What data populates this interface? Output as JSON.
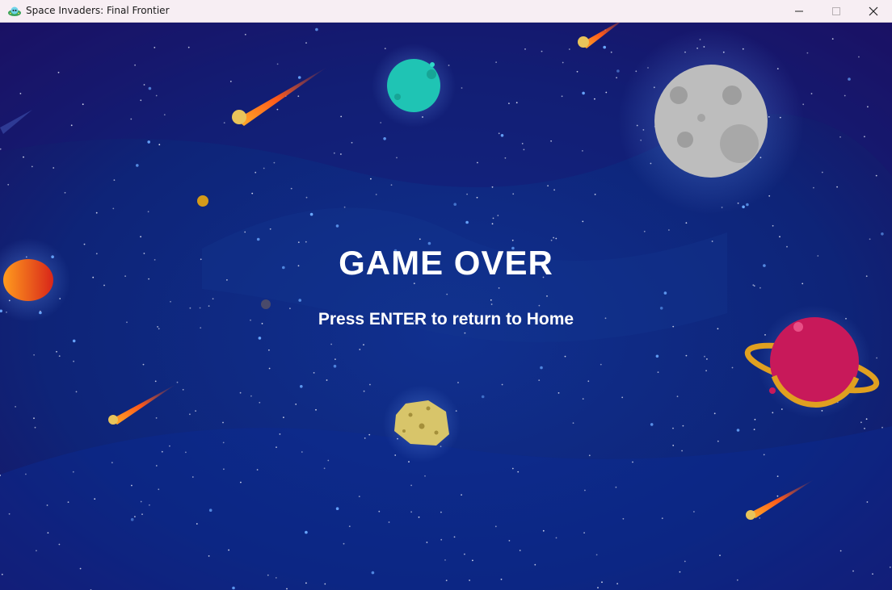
{
  "window": {
    "title": "Space Invaders: Final Frontier",
    "icon": "alien-ufo-icon",
    "controls": [
      "minimize-icon",
      "maximize-icon",
      "close-icon"
    ]
  },
  "game": {
    "headline": "GAME OVER",
    "prompt": "Press ENTER to return to Home"
  },
  "colors": {
    "titlebar": "#f7eef3",
    "space_dark": "#1c0f5e",
    "space_blue": "#0e2a8a",
    "text": "#ffffff",
    "moon": "#b9b9b9",
    "teal_planet": "#1fc4b4",
    "saturn": "#c8195a",
    "ring": "#e0a020",
    "asteroid": "#d8c56a",
    "comet": "#ff7a1a"
  }
}
